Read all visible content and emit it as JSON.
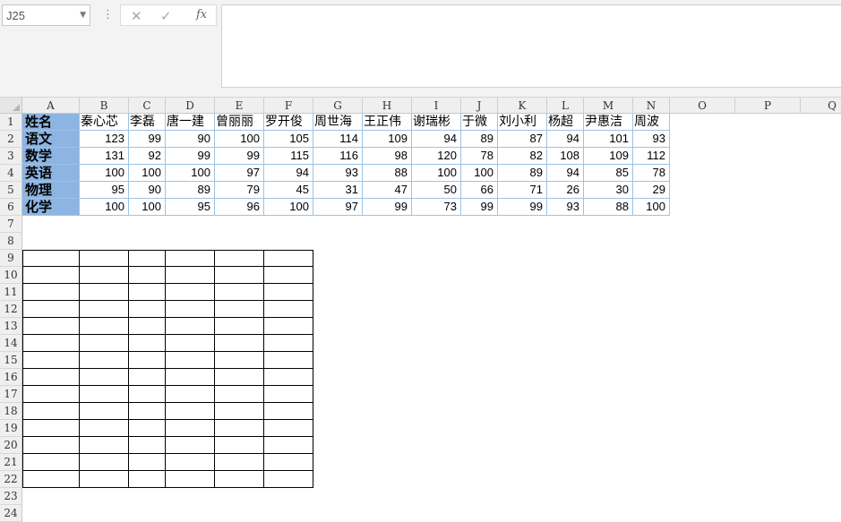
{
  "name_box": {
    "value": "J25"
  },
  "formula_bar": {
    "cancel_icon": "✕",
    "enter_icon": "✓",
    "fx_label": "fx",
    "value": ""
  },
  "columns": [
    "A",
    "B",
    "C",
    "D",
    "E",
    "F",
    "G",
    "H",
    "I",
    "J",
    "K",
    "L",
    "M",
    "N",
    "O",
    "P",
    "Q"
  ],
  "rows": [
    "1",
    "2",
    "3",
    "4",
    "5",
    "6",
    "7",
    "8",
    "9",
    "10",
    "11",
    "12",
    "13",
    "14",
    "15",
    "16",
    "17",
    "18",
    "19",
    "20",
    "21",
    "22",
    "23",
    "24"
  ],
  "table": {
    "corner_label": "姓名",
    "names": [
      "秦心芯",
      "李磊",
      "唐一建",
      "曾丽丽",
      "罗开俊",
      "周世海",
      "王正伟",
      "谢瑞彬",
      "于微",
      "刘小利",
      "杨超",
      "尹惠洁",
      "周波"
    ],
    "subjects": [
      {
        "label": "语文",
        "scores": [
          "123",
          "99",
          "90",
          "100",
          "105",
          "114",
          "109",
          "94",
          "89",
          "87",
          "94",
          "101",
          "93"
        ]
      },
      {
        "label": "数学",
        "scores": [
          "131",
          "92",
          "99",
          "99",
          "115",
          "116",
          "98",
          "120",
          "78",
          "82",
          "108",
          "109",
          "112"
        ]
      },
      {
        "label": "英语",
        "scores": [
          "100",
          "100",
          "100",
          "97",
          "94",
          "93",
          "88",
          "100",
          "100",
          "89",
          "94",
          "85",
          "78"
        ]
      },
      {
        "label": "物理",
        "scores": [
          "95",
          "90",
          "89",
          "79",
          "45",
          "31",
          "47",
          "50",
          "66",
          "71",
          "26",
          "30",
          "29"
        ]
      },
      {
        "label": "化学",
        "scores": [
          "100",
          "100",
          "95",
          "96",
          "100",
          "97",
          "99",
          "73",
          "99",
          "99",
          "93",
          "88",
          "100"
        ]
      }
    ]
  },
  "colors": {
    "header_fill": "#8db4e2",
    "table_border": "#9dc3e6",
    "grid_header": "#efefef"
  }
}
